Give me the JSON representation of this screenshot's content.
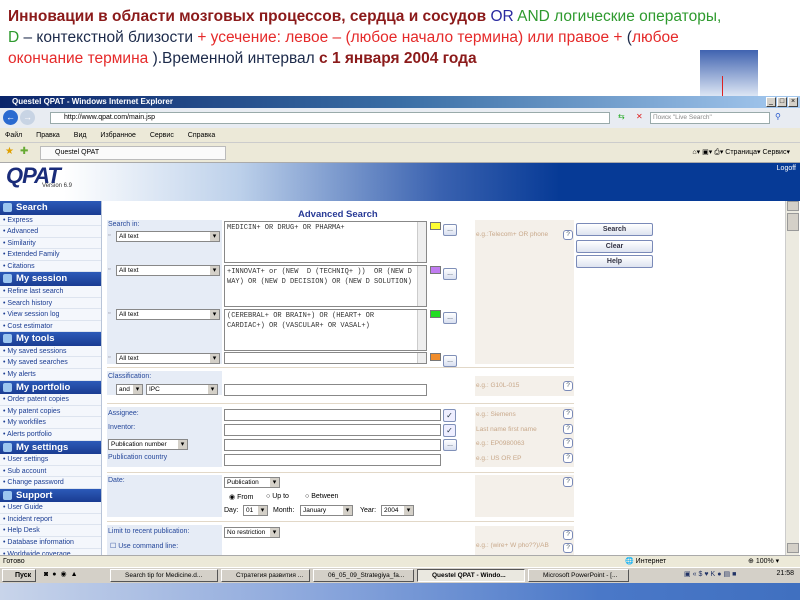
{
  "slide": {
    "title_parts": [
      {
        "text": "Инновации в области  мозговых процессов, сердца и сосудов ",
        "style": "b"
      },
      {
        "text": "OR ",
        "style": "blue"
      },
      {
        "text": "AND логические операторы, D ",
        "style": "green"
      },
      {
        "text": "– контекстной близости ",
        "style": "navy"
      },
      {
        "text": "+  усечение: левое – (любое начало термина)  или правое + ",
        "style": "red"
      },
      {
        "text": "(",
        "style": "navy"
      },
      {
        "text": "любое  окончание термина ",
        "style": "red"
      },
      {
        "text": ").Временной интервал  ",
        "style": "navy"
      },
      {
        "text": "с  1 января 2004 года",
        "style": "b"
      }
    ]
  },
  "browser": {
    "title": "Questel QPAT - Windows Internet Explorer",
    "url": "http://www.qpat.com/main.jsp",
    "live_search_placeholder": "Поиск \"Live Search\"",
    "menu": [
      "Файл",
      "Правка",
      "Вид",
      "Избранное",
      "Сервис",
      "Справка"
    ],
    "tab": "Questel QPAT",
    "page_label": "Страница",
    "tools_label": "Сервис"
  },
  "qpat": {
    "logo": "QPAT",
    "version": "Version 6.9",
    "logoff": "Logoff"
  },
  "sidebar": [
    {
      "title": "Search",
      "items": [
        "Express",
        "Advanced",
        "Similarity",
        "Extended Family",
        "Citations"
      ]
    },
    {
      "title": "My session",
      "items": [
        "Refine last search",
        "Search history",
        "View session log",
        "Cost estimator"
      ]
    },
    {
      "title": "My tools",
      "items": [
        "My saved sessions",
        "My saved searches",
        "My alerts"
      ]
    },
    {
      "title": "My portfolio",
      "items": [
        "Order patent copies",
        "My patent copies",
        "My workfiles",
        "Alerts portfolio"
      ]
    },
    {
      "title": "My settings",
      "items": [
        "User settings",
        "Sub account",
        "Change password"
      ]
    },
    {
      "title": "Support",
      "items": [
        "User Guide",
        "Incident report",
        "Help Desk",
        "Database information",
        "Worldwide coverage"
      ]
    }
  ],
  "form": {
    "title": "Advanced Search",
    "search_in_label": "Search in:",
    "rows": [
      {
        "field": "All text",
        "query": "MEDICIN+ OR DRUG+ OR PHARMA+",
        "color": "#ffff33"
      },
      {
        "field": "All text",
        "query": "+INNOVAT+ or (NEW  D (TECHNIQ+ ))  OR (NEW D WAY) OR (NEW D DECISION) OR (NEW D SOLUTION)",
        "color": "#c07cf0"
      },
      {
        "field": "All text",
        "query": "(CEREBRAL+ OR BRAIN+) OR (HEART+ OR CARDIAC+) OR (VASCULAR+ OR VASAL+)",
        "color": "#22dd22"
      },
      {
        "field": "All text",
        "query": "",
        "color": "#f08c2a"
      }
    ],
    "example_query": "e.g.:Telecom+ OR phone",
    "buttons": {
      "search": "Search",
      "clear": "Clear",
      "help": "Help"
    },
    "classification": {
      "label": "Classification:",
      "operator": "and",
      "scheme": "IPC",
      "example": "e.g.: G10L-015"
    },
    "assignee": {
      "label": "Assignee:",
      "example": "e.g.: Siemens"
    },
    "inventor": {
      "label": "Inventor:",
      "example": "Last name first name"
    },
    "pubnum": {
      "select": "Publication number",
      "example": "e.g.: EP0980063"
    },
    "pubcountry": {
      "label": "Publication country",
      "example": "e.g.: US OR EP"
    },
    "date": {
      "label": "Date:",
      "type": "Publication",
      "radios": [
        "From",
        "Up to",
        "Between"
      ],
      "selected": "From",
      "day_label": "Day:",
      "day": "01",
      "month_label": "Month:",
      "month": "January",
      "year_label": "Year:",
      "year": "2004"
    },
    "limit": {
      "label": "Limit to recent publication:",
      "value": "No restriction"
    },
    "command_line": {
      "label": "Use command line:",
      "checked": false,
      "example": "e.g.: (wire+ W pho??)/AB"
    },
    "help_glyph": "?"
  },
  "status": {
    "text": "Готово",
    "zone": "Интернет",
    "zoom": "100%"
  },
  "taskbar": {
    "start": "Пуск",
    "tasks": [
      "Search tip for Medicine.d...",
      "Стратегия  развития  ...",
      "06_05_09_Strategiya_fa...",
      "Questel QPAT - Windo...",
      "Microsoft PowerPoint - [..."
    ],
    "active": 3,
    "clock": "21:58"
  }
}
